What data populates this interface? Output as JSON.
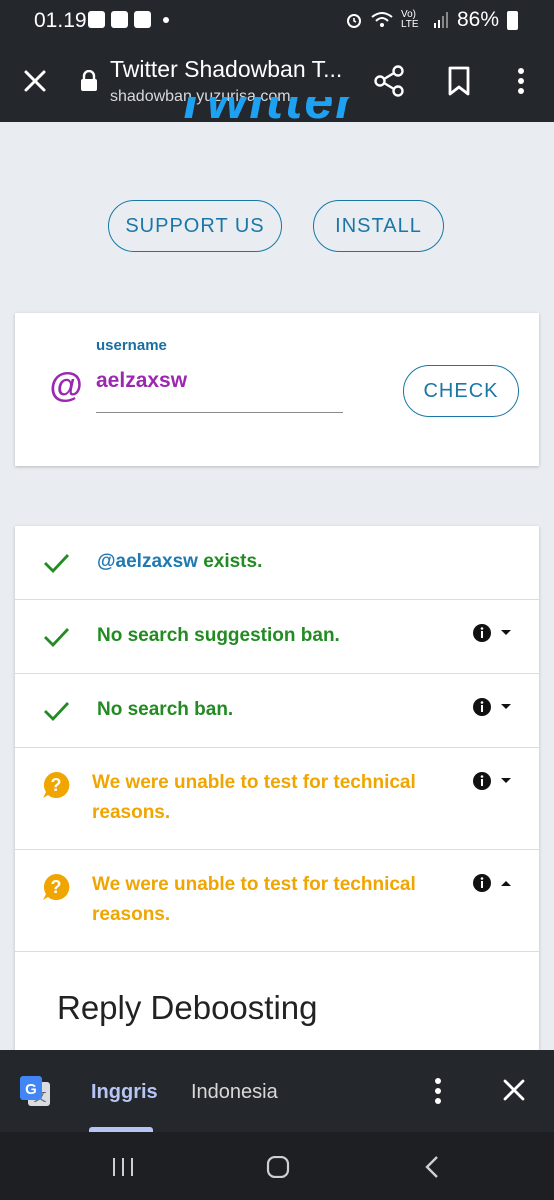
{
  "status_bar": {
    "time": "01.19",
    "battery": "86%",
    "network": "Vo) LTE"
  },
  "browser": {
    "title": "Twitter Shadowban T...",
    "url": "shadowban.yuzurisa.com",
    "icons": [
      "close-icon",
      "lock-icon",
      "share-icon",
      "bookmark-icon",
      "more-vert-icon"
    ]
  },
  "page": {
    "logo_fragment": "Twitter",
    "buttons": {
      "support": "SUPPORT US",
      "install": "INSTALL"
    },
    "form": {
      "at_symbol": "@",
      "label": "username",
      "value": "aelzaxsw",
      "check_label": "CHECK"
    },
    "results": [
      {
        "handle": "@aelzaxsw",
        "text": " exists.",
        "status": "ok",
        "has_info": false
      },
      {
        "text": "No search suggestion ban.",
        "status": "ok",
        "has_info": true,
        "expanded": false
      },
      {
        "text": "No search ban.",
        "status": "ok",
        "has_info": true,
        "expanded": false
      },
      {
        "text": "We were unable to test for technical reasons.",
        "status": "warn",
        "has_info": true,
        "expanded": false
      },
      {
        "text": "We were unable to test for technical reasons.",
        "status": "warn",
        "has_info": true,
        "expanded": true
      }
    ],
    "section_title": "Reply Deboosting"
  },
  "translate_bar": {
    "active_language": "Inggris",
    "other_language": "Indonesia"
  },
  "colors": {
    "ok": "#228b22",
    "warn": "#f0a500",
    "accent": "#1877a6",
    "purple": "#9c27b0",
    "translate_active": "#b7c5f5"
  }
}
